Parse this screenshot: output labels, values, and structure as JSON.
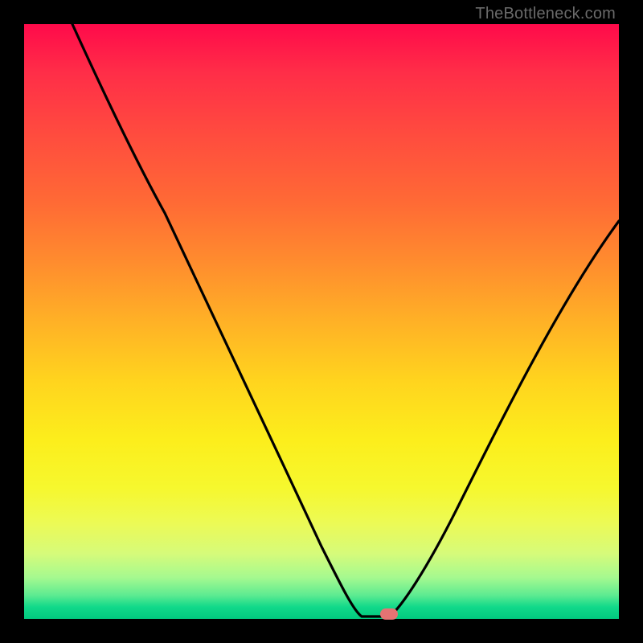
{
  "watermark": "TheBottleneck.com",
  "colors": {
    "curve_stroke": "#000000",
    "marker_fill": "#e57373",
    "frame_bg": "#000000"
  },
  "chart_data": {
    "type": "line",
    "title": "",
    "xlabel": "",
    "ylabel": "",
    "xlim": [
      0,
      1
    ],
    "ylim": [
      0,
      1
    ],
    "x": [
      0.0,
      0.05,
      0.1,
      0.15,
      0.2,
      0.25,
      0.3,
      0.35,
      0.4,
      0.45,
      0.5,
      0.53,
      0.56,
      0.58,
      0.6,
      0.63,
      0.66,
      0.7,
      0.75,
      0.8,
      0.85,
      0.9,
      0.95,
      1.0
    ],
    "values": [
      1.0,
      0.92,
      0.83,
      0.74,
      0.67,
      0.6,
      0.52,
      0.43,
      0.34,
      0.24,
      0.13,
      0.06,
      0.02,
      0.0,
      0.0,
      0.01,
      0.04,
      0.1,
      0.19,
      0.28,
      0.38,
      0.48,
      0.58,
      0.67
    ],
    "marker": {
      "x": 0.6,
      "y": 0.0
    },
    "gradient_stops": [
      {
        "pos": 0.0,
        "color": "#ff0a4a"
      },
      {
        "pos": 0.5,
        "color": "#ffd41e"
      },
      {
        "pos": 0.78,
        "color": "#f6f82e"
      },
      {
        "pos": 1.0,
        "color": "#02c97f"
      }
    ]
  }
}
